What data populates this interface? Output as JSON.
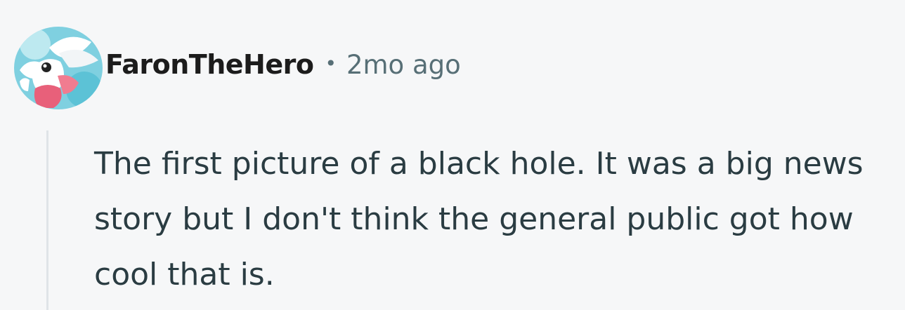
{
  "comment": {
    "author": {
      "username": "FaronTheHero",
      "avatar_icon": "user-avatar"
    },
    "separator": "•",
    "timestamp": "2mo ago",
    "body": "The first picture of a black hole. It was a big news story but I don't think the general public got how cool that is."
  },
  "colors": {
    "background": "#f6f7f8",
    "username": "#1c1c1c",
    "meta": "#576f76",
    "body_text": "#2a3c42",
    "thread_line": "#dfe4e8"
  }
}
